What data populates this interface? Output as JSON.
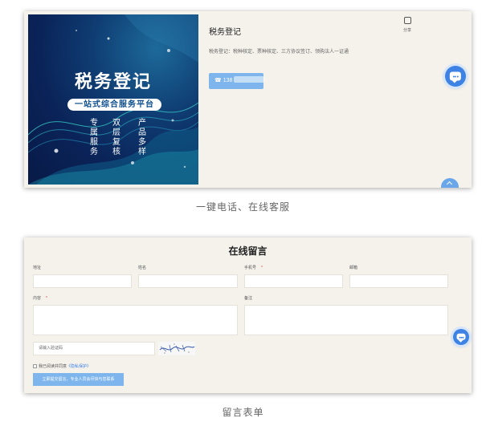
{
  "product_card": {
    "banner": {
      "title": "税务登记",
      "subtitle": "一站式综合服务平台",
      "columns": [
        "专属服务",
        "双层复核",
        "产品多样"
      ]
    },
    "title": "税务登记",
    "description": "税务登记：税种核定、票种核定、三方协议签订、领购法人一证通",
    "phone_prefix": "138",
    "share_label": "分享"
  },
  "caption_1": "一键电话、在线客服",
  "message_form": {
    "title": "在线留言",
    "fields": {
      "address": "地址",
      "name": "姓名",
      "phone": "手机号",
      "email": "邮箱",
      "content": "内容",
      "remark": "备注",
      "required_mark": "*"
    },
    "captcha_placeholder": "请输入验证码",
    "consent_text": "我已阅读并同意",
    "consent_link": "《隐私保护》",
    "submit_label": "立即提交留言，专业人员会尽快与您联系"
  },
  "caption_2": "留言表单",
  "colors": {
    "accent": "#3e82e4",
    "button": "#7db5ec",
    "card_bg": "#f5f2ec",
    "banner_bg": "#0a2358"
  },
  "icons": {
    "share": "share-icon",
    "phone": "phone-icon",
    "chat": "chat-icon",
    "top": "chevron-up-icon"
  }
}
